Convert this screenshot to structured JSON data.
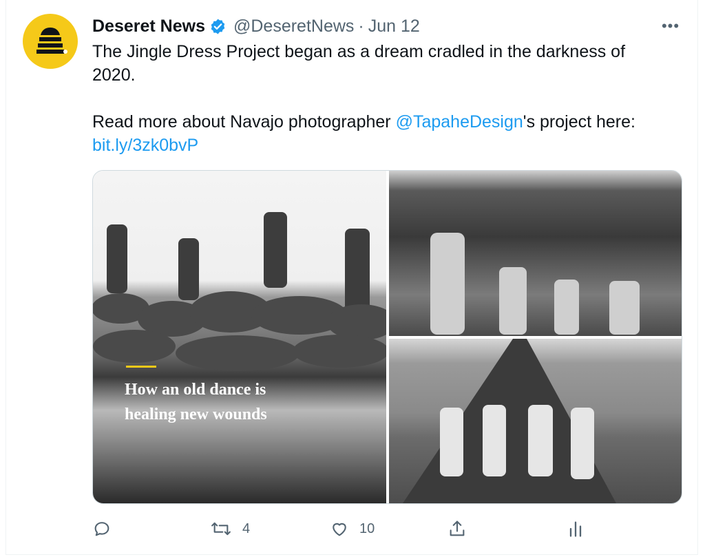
{
  "tweet": {
    "author_name": "Deseret News",
    "handle": "@DeseretNews",
    "separator": "·",
    "date": "Jun 12",
    "more_label": "•••",
    "text_line1": "The Jingle Dress Project began as a dream cradled in the darkness of 2020.",
    "text_line2_before": "Read more about Navajo photographer ",
    "text_line2_mention": "@TapaheDesign",
    "text_line2_after": "'s project here:",
    "text_link": "bit.ly/3zk0bvP"
  },
  "media": {
    "overlay_title_line1": "How an old dance is",
    "overlay_title_line2": "healing new wounds"
  },
  "actions": {
    "reply_count": "",
    "retweet_count": "4",
    "like_count": "10"
  },
  "colors": {
    "accent": "#1d9bf0",
    "avatar_bg": "#f5c919",
    "secondary_text": "#536471"
  },
  "icons": [
    "beehive-logo-icon",
    "verified-badge-icon",
    "more-options-icon",
    "reply-icon",
    "retweet-icon",
    "like-icon",
    "share-icon",
    "analytics-icon"
  ]
}
